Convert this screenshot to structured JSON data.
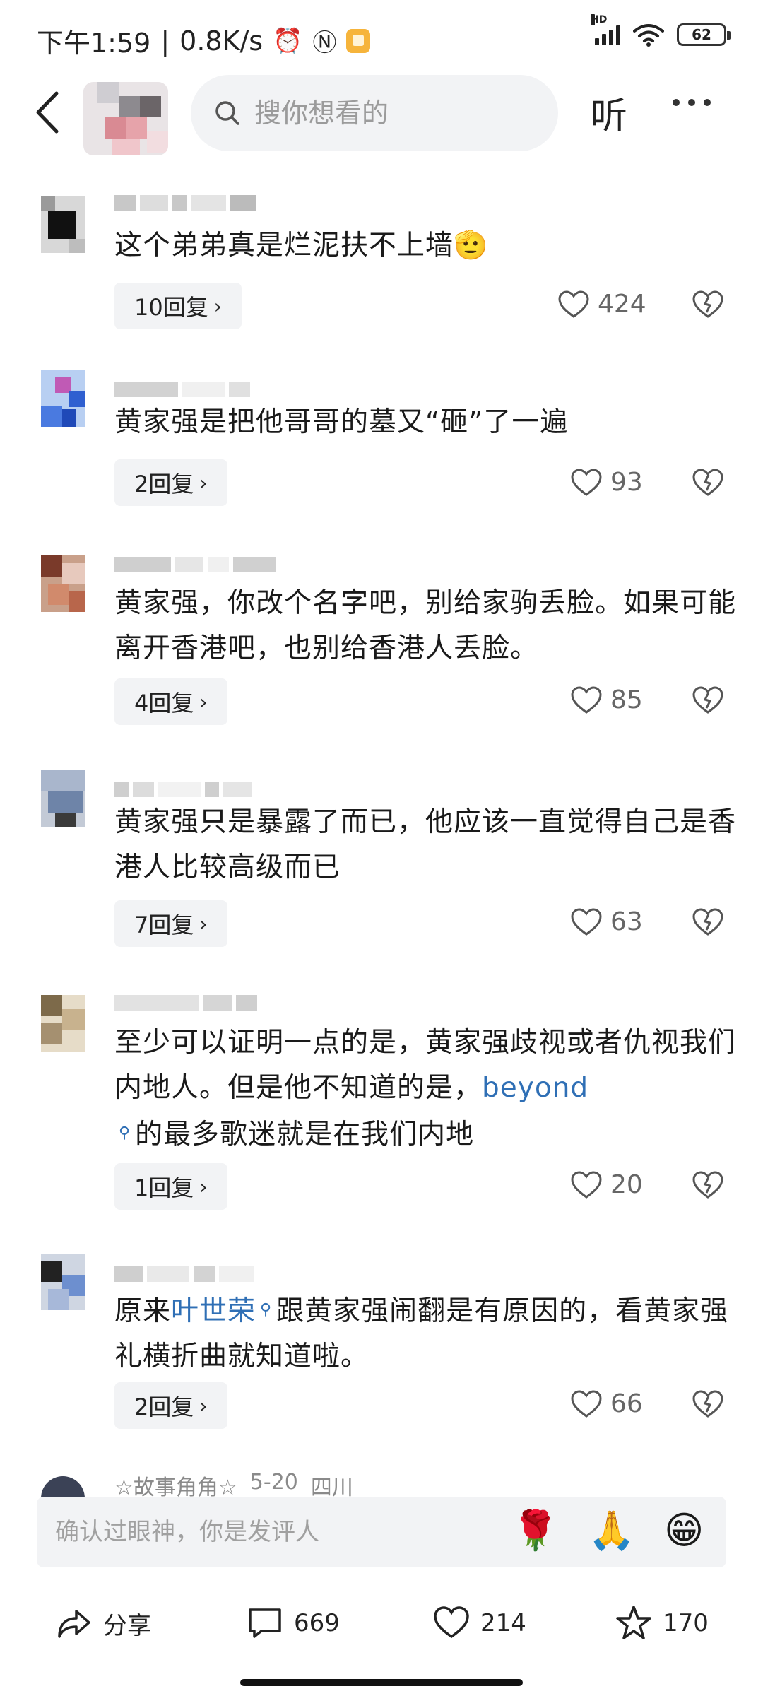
{
  "status_bar": {
    "time": "下午1:59",
    "speed": "0.8K/s",
    "network_label": "HD",
    "battery": "62"
  },
  "top_nav": {
    "search_placeholder": "搜你想看的",
    "listen_label": "听"
  },
  "comments": [
    {
      "text": "这个弟弟真是烂泥扶不上墙",
      "emoji": "🫡",
      "replies": "10回复",
      "likes": "424"
    },
    {
      "text": "黄家强是把他哥哥的墓又“砸”了一遍",
      "replies": "2回复",
      "likes": "93"
    },
    {
      "text": "黄家强，你改个名字吧，别给家驹丢脸。如果可能离开香港吧，也别给香港人丢脸。",
      "replies": "4回复",
      "likes": "85"
    },
    {
      "text": "黄家强只是暴露了而已，他应该一直觉得自己是香港人比较高级而已",
      "replies": "7回复",
      "likes": "63"
    },
    {
      "text_before": "至少可以证明一点的是，黄家强歧视或者仇视我们内地人。但是他不知道的是，",
      "link": "beyond",
      "text_after": "的最多歌迷就是在我们内地",
      "replies": "1回复",
      "likes": "20"
    },
    {
      "text_before": "原来",
      "link": "叶世荣",
      "text_after": "跟黄家强闹翻是有原因的，看黄家强礼横折曲就知道啦。",
      "replies": "2回复",
      "likes": "66"
    }
  ],
  "partial_comment": {
    "name": "☆故事角角☆",
    "date": "5-20",
    "region": "四川"
  },
  "bottom": {
    "input_placeholder": "确认过眼神，你是发评人",
    "emojis": [
      "🌹",
      "🙏",
      "😁"
    ],
    "share_label": "分享",
    "comment_count": "669",
    "like_count": "214",
    "favorite_count": "170"
  }
}
